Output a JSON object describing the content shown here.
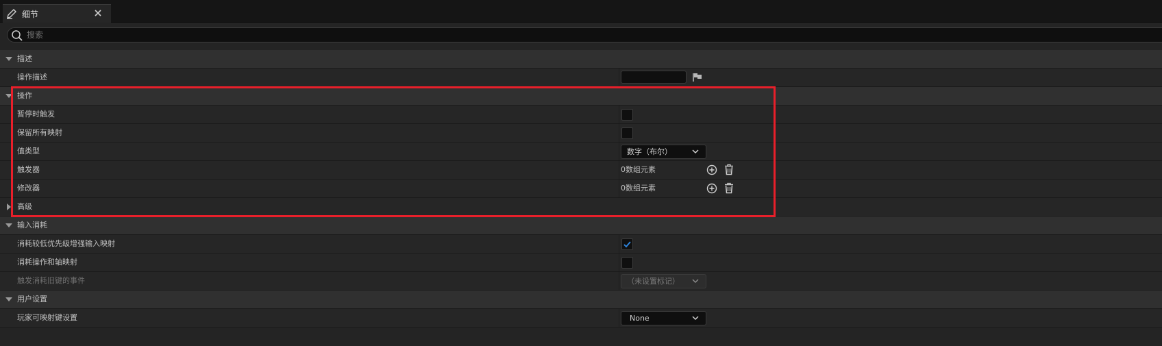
{
  "tab": {
    "title": "细节",
    "icon": "edit-icon",
    "close_icon": "close-icon"
  },
  "search": {
    "placeholder": "搜索",
    "value": "",
    "icon": "search-icon"
  },
  "sections": {
    "description": {
      "title": "描述",
      "action_description": {
        "label": "操作描述",
        "value": ""
      }
    },
    "action": {
      "title": "操作",
      "trigger_when_paused": {
        "label": "暂停时触发",
        "checked": false
      },
      "reserve_all_mappings": {
        "label": "保留所有映射",
        "checked": false
      },
      "value_type": {
        "label": "值类型",
        "selected": "数字（布尔）"
      },
      "triggers": {
        "label": "触发器",
        "count_text": "0数组元素"
      },
      "modifiers": {
        "label": "修改器",
        "count_text": "0数组元素"
      },
      "advanced": {
        "title": "高级"
      }
    },
    "input_consumption": {
      "title": "输入消耗",
      "consume_lower_priority": {
        "label": "消耗较低优先级增强输入映射",
        "checked": true
      },
      "consume_action_axis": {
        "label": "消耗操作和轴映射",
        "checked": false
      },
      "trigger_consumed_legacy": {
        "label": "触发消耗旧键的事件",
        "selected": "（未设置标记）",
        "disabled": true
      }
    },
    "user_settings": {
      "title": "用户设置",
      "player_mappable_key_settings": {
        "label": "玩家可映射键设置",
        "selected": "None"
      }
    }
  },
  "colors": {
    "background": "#242424",
    "section_header": "#303030",
    "highlight_border": "#e81f2a",
    "checkmark": "#2f86e0"
  }
}
